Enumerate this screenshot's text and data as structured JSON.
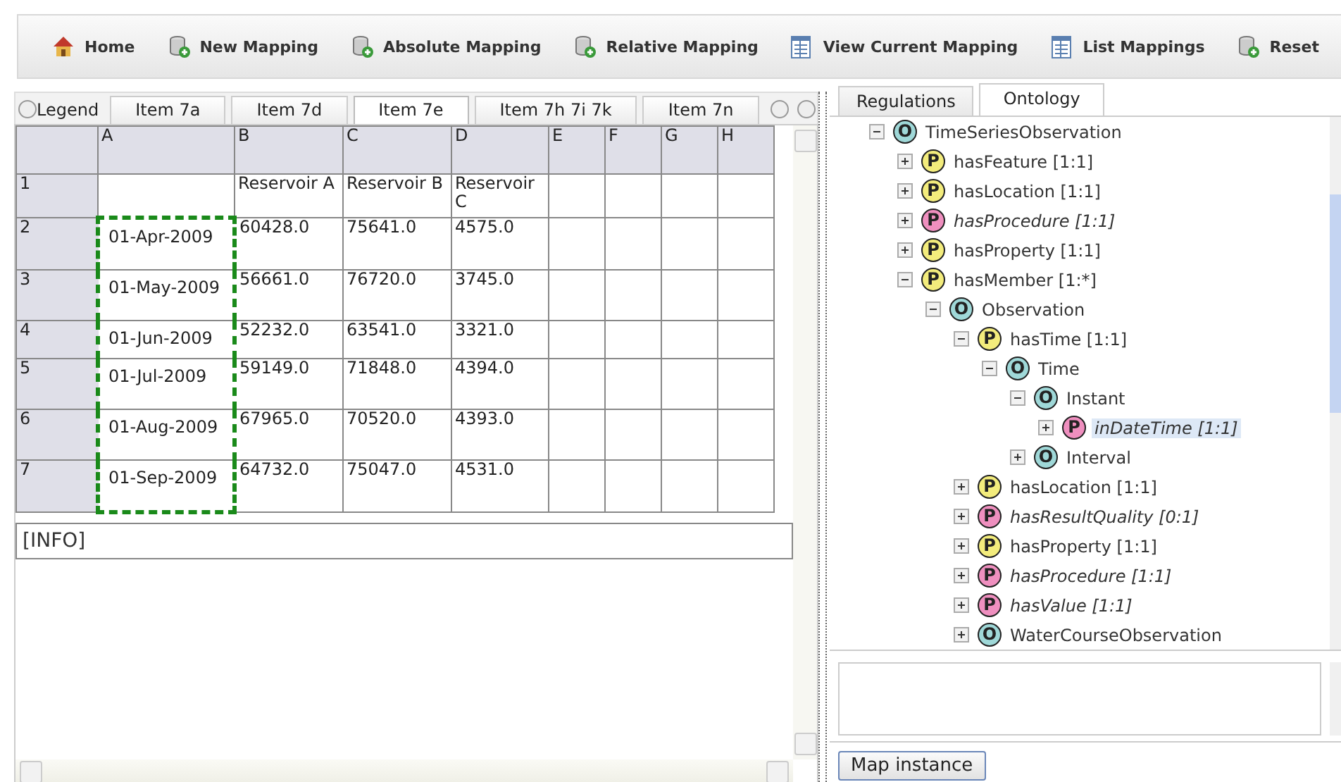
{
  "toolbar": [
    {
      "label": "Home",
      "kind": "home"
    },
    {
      "label": "New Mapping",
      "kind": "database"
    },
    {
      "label": "Absolute Mapping",
      "kind": "database"
    },
    {
      "label": "Relative Mapping",
      "kind": "database"
    },
    {
      "label": "View Current Mapping",
      "kind": "sheet"
    },
    {
      "label": "List Mappings",
      "kind": "sheet"
    },
    {
      "label": "Reset",
      "kind": "database"
    }
  ],
  "sheet_tabs": [
    {
      "label": "Legend",
      "selected": false
    },
    {
      "label": "Item 7a",
      "selected": false
    },
    {
      "label": "Item 7d",
      "selected": false
    },
    {
      "label": "Item 7e",
      "selected": true
    },
    {
      "label": "Item 7h 7i 7k",
      "selected": false
    },
    {
      "label": "Item 7n",
      "selected": false
    }
  ],
  "table": {
    "columns": [
      "A",
      "B",
      "C",
      "D",
      "E",
      "F",
      "G",
      "H"
    ],
    "rows": [
      {
        "header": "1",
        "marked": false,
        "cells": [
          "",
          "Reservoir A",
          "Reservoir B",
          "Reservoir C",
          "",
          "",
          "",
          ""
        ]
      },
      {
        "header": "2",
        "marked": true,
        "cells": [
          "01-Apr-2009",
          "60428.0",
          "75641.0",
          "4575.0",
          "",
          "",
          "",
          ""
        ]
      },
      {
        "header": "3",
        "marked": true,
        "cells": [
          "01-May-2009",
          "56661.0",
          "76720.0",
          "3745.0",
          "",
          "",
          "",
          ""
        ]
      },
      {
        "header": "4",
        "marked": true,
        "cells": [
          "01-Jun-2009",
          "52232.0",
          "63541.0",
          "3321.0",
          "",
          "",
          "",
          ""
        ]
      },
      {
        "header": "5",
        "marked": true,
        "cells": [
          "01-Jul-2009",
          "59149.0",
          "71848.0",
          "4394.0",
          "",
          "",
          "",
          ""
        ]
      },
      {
        "header": "6",
        "marked": true,
        "cells": [
          "01-Aug-2009",
          "67965.0",
          "70520.0",
          "4393.0",
          "",
          "",
          "",
          ""
        ]
      },
      {
        "header": "7",
        "marked": true,
        "cells": [
          "01-Sep-2009",
          "64732.0",
          "75047.0",
          "4531.0",
          "",
          "",
          "",
          ""
        ]
      }
    ]
  },
  "info": "[INFO]",
  "side_tabs": [
    {
      "label": "Regulations",
      "selected": false
    },
    {
      "label": "Ontology",
      "selected": true
    }
  ],
  "tree": [
    {
      "label": "TimeSeriesObservation",
      "badge": "O",
      "kind": "class",
      "expanded": true,
      "selected": false,
      "children": [
        {
          "label": "hasFeature [1:1]",
          "badge": "P",
          "kind": "property",
          "expanded": false,
          "selected": false
        },
        {
          "label": "hasLocation [1:1]",
          "badge": "P",
          "kind": "property",
          "expanded": false,
          "selected": false
        },
        {
          "label": "hasProcedure [1:1]",
          "badge": "P",
          "kind": "optional",
          "expanded": false,
          "selected": false
        },
        {
          "label": "hasProperty [1:1]",
          "badge": "P",
          "kind": "property",
          "expanded": false,
          "selected": false
        },
        {
          "label": "hasMember [1:*]",
          "badge": "P",
          "kind": "property",
          "expanded": true,
          "selected": false,
          "children": [
            {
              "label": "Observation",
              "badge": "O",
              "kind": "class",
              "expanded": true,
              "selected": false,
              "children": [
                {
                  "label": "hasTime [1:1]",
                  "badge": "P",
                  "kind": "property",
                  "expanded": true,
                  "selected": false,
                  "children": [
                    {
                      "label": "Time",
                      "badge": "O",
                      "kind": "class",
                      "expanded": true,
                      "selected": false,
                      "children": [
                        {
                          "label": "Instant",
                          "badge": "O",
                          "kind": "class",
                          "expanded": true,
                          "selected": false,
                          "children": [
                            {
                              "label": "inDateTime [1:1]",
                              "badge": "P",
                              "kind": "optional",
                              "expanded": false,
                              "selected": true
                            }
                          ]
                        },
                        {
                          "label": "Interval",
                          "badge": "O",
                          "kind": "class",
                          "expanded": false,
                          "selected": false
                        }
                      ]
                    }
                  ]
                },
                {
                  "label": "hasLocation [1:1]",
                  "badge": "P",
                  "kind": "property",
                  "expanded": false,
                  "selected": false
                },
                {
                  "label": "hasResultQuality [0:1]",
                  "badge": "P",
                  "kind": "optional",
                  "expanded": false,
                  "selected": false
                },
                {
                  "label": "hasProperty [1:1]",
                  "badge": "P",
                  "kind": "property",
                  "expanded": false,
                  "selected": false
                },
                {
                  "label": "hasProcedure [1:1]",
                  "badge": "P",
                  "kind": "optional",
                  "expanded": false,
                  "selected": false
                },
                {
                  "label": "hasValue [1:1]",
                  "badge": "P",
                  "kind": "optional",
                  "expanded": false,
                  "selected": false
                },
                {
                  "label": "WaterCourseObservation",
                  "badge": "O",
                  "kind": "class",
                  "expanded": false,
                  "selected": false
                }
              ]
            }
          ]
        }
      ]
    }
  ],
  "map_button": "Map instance"
}
